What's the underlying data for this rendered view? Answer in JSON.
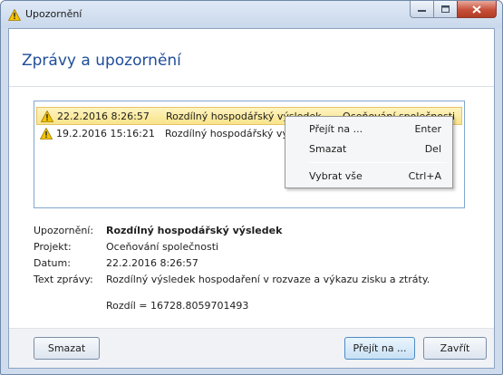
{
  "window": {
    "title": "Upozornění",
    "accent_color": "#1f4d9a"
  },
  "header": {
    "title": "Zprávy a upozornění"
  },
  "messages": [
    {
      "date": "22.2.2016 8:26:57",
      "title": "Rozdílný hospodářský výsledek",
      "project": "Oceňování společnosti",
      "selected": true,
      "icon": "warning-icon"
    },
    {
      "date": "19.2.2016 15:16:21",
      "title": "Rozdílný hospodářský vý",
      "project": "",
      "selected": false,
      "icon": "warning-icon"
    }
  ],
  "context_menu": {
    "items": [
      {
        "label": "Přejít na ...",
        "shortcut": "Enter"
      },
      {
        "label": "Smazat",
        "shortcut": "Del"
      },
      {
        "label": "Vybrat vše",
        "shortcut": "Ctrl+A"
      }
    ]
  },
  "detail": {
    "alert_label": "Upozornění:",
    "alert_value": "Rozdílný hospodářský výsledek",
    "project_label": "Projekt:",
    "project_value": "Oceňování společnosti",
    "date_label": "Datum:",
    "date_value": "22.2.2016 8:26:57",
    "text_label": "Text zprávy:",
    "text_value": "Rozdílný výsledek hospodaření v rozvaze a výkazu zisku a ztráty.",
    "diff_text": "Rozdíl = 16728.8059701493"
  },
  "footer": {
    "delete_label": "Smazat",
    "goto_label": "Přejít na ...",
    "close_label": "Zavřít"
  }
}
